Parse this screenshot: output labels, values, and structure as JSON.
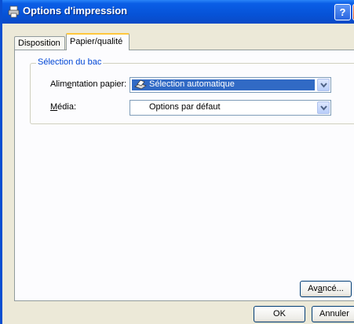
{
  "window": {
    "title": "Options d'impression",
    "help_glyph": "?",
    "close_glyph": "x"
  },
  "tabs": [
    {
      "label": "Disposition",
      "active": false
    },
    {
      "label": "Papier/qualité",
      "active": true
    }
  ],
  "tray_group": {
    "title": "Sélection du bac",
    "paper_source": {
      "label_pre": "Alim",
      "label_mnemonic": "e",
      "label_post": "ntation papier:",
      "value": "Sélection automatique"
    },
    "media": {
      "label_mnemonic": "M",
      "label_post": "édia:",
      "value": "Options par défaut"
    }
  },
  "buttons": {
    "advanced": {
      "pre": "Av",
      "mnemonic": "a",
      "post": "ncé..."
    },
    "ok": "OK",
    "cancel": "Annuler"
  },
  "colors": {
    "titlebar": "#0653d8",
    "active_tab_accent": "#ffc73c",
    "group_title": "#0046d5",
    "selection": "#316ac5"
  }
}
